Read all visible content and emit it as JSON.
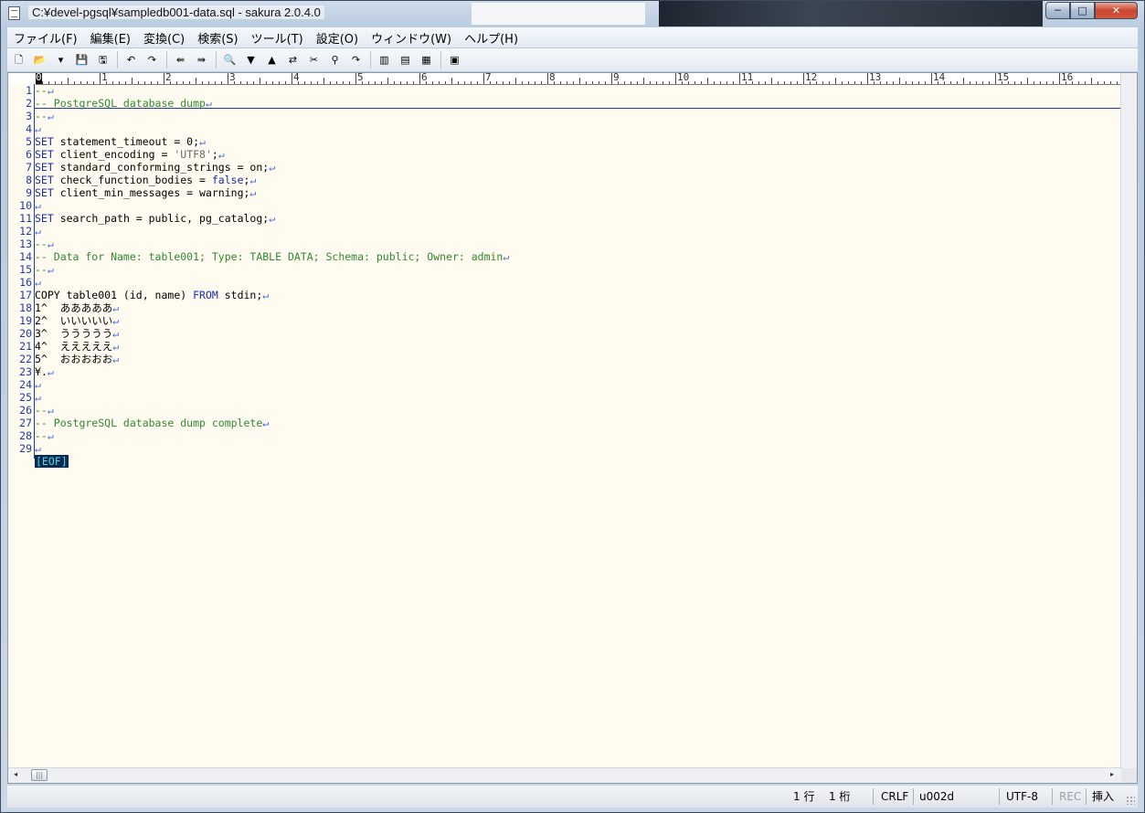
{
  "window": {
    "title": "C:¥devel-pgsql¥sampledb001-data.sql - sakura 2.0.4.0",
    "controls": {
      "minimize": "─",
      "maximize": "□",
      "close": "✕"
    }
  },
  "menu": [
    "ファイル(F)",
    "編集(E)",
    "変換(C)",
    "検索(S)",
    "ツール(T)",
    "設定(O)",
    "ウィンドウ(W)",
    "ヘルプ(H)"
  ],
  "toolbar": {
    "buttons": [
      {
        "name": "new-file-icon",
        "glyph": "🗋"
      },
      {
        "name": "open-file-icon",
        "glyph": "📂"
      },
      {
        "name": "open-dropdown-icon",
        "glyph": "▾"
      },
      {
        "name": "save-icon",
        "glyph": "💾"
      },
      {
        "name": "save-as-icon",
        "glyph": "🖫"
      },
      {
        "name": "sep"
      },
      {
        "name": "undo-icon",
        "glyph": "↶"
      },
      {
        "name": "redo-icon",
        "glyph": "↷"
      },
      {
        "name": "sep"
      },
      {
        "name": "back-icon",
        "glyph": "⇚"
      },
      {
        "name": "forward-icon",
        "glyph": "⇛"
      },
      {
        "name": "sep"
      },
      {
        "name": "search-icon",
        "glyph": "🔍"
      },
      {
        "name": "search-next-icon",
        "glyph": "▼"
      },
      {
        "name": "search-prev-icon",
        "glyph": "▲"
      },
      {
        "name": "replace-icon",
        "glyph": "⇄"
      },
      {
        "name": "clear-search-mark-icon",
        "glyph": "✂"
      },
      {
        "name": "grep-icon",
        "glyph": "⚲"
      },
      {
        "name": "jump-icon",
        "glyph": "↷"
      },
      {
        "name": "sep"
      },
      {
        "name": "outline-icon",
        "glyph": "▥"
      },
      {
        "name": "compare-icon",
        "glyph": "▤"
      },
      {
        "name": "diff-icon",
        "glyph": "▦"
      },
      {
        "name": "sep"
      },
      {
        "name": "settings-icon",
        "glyph": "▣"
      }
    ]
  },
  "ruler": {
    "cursor_label": "0",
    "numbers": [
      "1",
      "2",
      "3",
      "4",
      "5",
      "6",
      "7",
      "8",
      "9",
      "10",
      "11",
      "12",
      "13",
      "14",
      "15",
      "16"
    ]
  },
  "editor": {
    "return_mark": "↵",
    "eof_mark": "[EOF]",
    "lines": [
      {
        "num": "1",
        "segments": [
          {
            "t": "--",
            "c": "c-comment"
          }
        ]
      },
      {
        "num": "2",
        "segments": [
          {
            "t": "-- PostgreSQL database dump",
            "c": "c-comment"
          }
        ]
      },
      {
        "num": "3",
        "segments": [
          {
            "t": "--",
            "c": "c-comment"
          }
        ]
      },
      {
        "num": "4",
        "segments": []
      },
      {
        "num": "5",
        "segments": [
          {
            "t": "SET",
            "c": "c-kw"
          },
          {
            "t": " statement_timeout = 0;",
            "c": ""
          }
        ]
      },
      {
        "num": "6",
        "segments": [
          {
            "t": "SET",
            "c": "c-kw"
          },
          {
            "t": " client_encoding = ",
            "c": ""
          },
          {
            "t": "'UTF8'",
            "c": "c-str"
          },
          {
            "t": ";",
            "c": ""
          }
        ]
      },
      {
        "num": "7",
        "segments": [
          {
            "t": "SET",
            "c": "c-kw"
          },
          {
            "t": " standard_conforming_strings = on;",
            "c": ""
          }
        ]
      },
      {
        "num": "8",
        "segments": [
          {
            "t": "SET",
            "c": "c-kw"
          },
          {
            "t": " check_function_bodies = ",
            "c": ""
          },
          {
            "t": "false",
            "c": "c-kw"
          },
          {
            "t": ";",
            "c": ""
          }
        ]
      },
      {
        "num": "9",
        "segments": [
          {
            "t": "SET",
            "c": "c-kw"
          },
          {
            "t": " client_min_messages = warning;",
            "c": ""
          }
        ]
      },
      {
        "num": "10",
        "segments": []
      },
      {
        "num": "11",
        "segments": [
          {
            "t": "SET",
            "c": "c-kw"
          },
          {
            "t": " search_path = public, pg_catalog;",
            "c": ""
          }
        ]
      },
      {
        "num": "12",
        "segments": []
      },
      {
        "num": "13",
        "segments": [
          {
            "t": "--",
            "c": "c-comment"
          }
        ]
      },
      {
        "num": "14",
        "segments": [
          {
            "t": "-- Data for Name: table001; Type: TABLE DATA; Schema: public; Owner: admin",
            "c": "c-comment"
          }
        ]
      },
      {
        "num": "15",
        "segments": [
          {
            "t": "--",
            "c": "c-comment"
          }
        ]
      },
      {
        "num": "16",
        "segments": []
      },
      {
        "num": "17",
        "segments": [
          {
            "t": "COPY table001 (id, name) ",
            "c": ""
          },
          {
            "t": "FROM",
            "c": "c-kw"
          },
          {
            "t": " stdin;",
            "c": ""
          }
        ]
      },
      {
        "num": "18",
        "segments": [
          {
            "t": "1^  あああああ",
            "c": ""
          }
        ]
      },
      {
        "num": "19",
        "segments": [
          {
            "t": "2^  いいいいい",
            "c": ""
          }
        ]
      },
      {
        "num": "20",
        "segments": [
          {
            "t": "3^  ううううう",
            "c": ""
          }
        ]
      },
      {
        "num": "21",
        "segments": [
          {
            "t": "4^  えええええ",
            "c": ""
          }
        ]
      },
      {
        "num": "22",
        "segments": [
          {
            "t": "5^  おおおおお",
            "c": ""
          }
        ]
      },
      {
        "num": "23",
        "segments": [
          {
            "t": "¥.",
            "c": ""
          }
        ]
      },
      {
        "num": "24",
        "segments": []
      },
      {
        "num": "25",
        "segments": []
      },
      {
        "num": "26",
        "segments": [
          {
            "t": "--",
            "c": "c-comment"
          }
        ]
      },
      {
        "num": "27",
        "segments": [
          {
            "t": "-- PostgreSQL database dump complete",
            "c": "c-comment"
          }
        ]
      },
      {
        "num": "28",
        "segments": [
          {
            "t": "--",
            "c": "c-comment"
          }
        ]
      },
      {
        "num": "29",
        "segments": []
      }
    ]
  },
  "scrollbar": {
    "left_arrow": "◂",
    "right_arrow": "▸",
    "thumb_grip": "|||"
  },
  "status": {
    "row": "1 行",
    "col": "1 桁",
    "eol": "CRLF",
    "char_code": "u002d",
    "encoding": "UTF-8",
    "rec": "REC",
    "mode": "挿入"
  },
  "colors": {
    "editor_bg": "#fffbf0",
    "line_number": "#1b3ca8",
    "comment": "#2f8a2f",
    "keyword": "#1b2ea8",
    "eof_bg": "#0a2850",
    "eof_fg": "#3fe0e0"
  }
}
